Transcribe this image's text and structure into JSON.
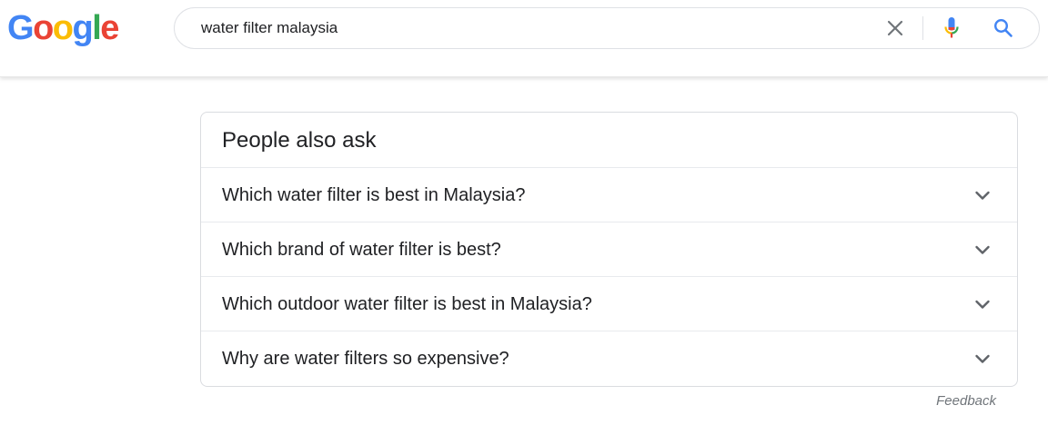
{
  "logo": {
    "letters": [
      "G",
      "o",
      "o",
      "g",
      "l",
      "e"
    ],
    "colors": [
      "#4285F4",
      "#EA4335",
      "#FBBC05",
      "#4285F4",
      "#34A853",
      "#EA4335"
    ]
  },
  "search": {
    "value": "water filter malaysia",
    "clear_icon": "close-icon",
    "mic_icon": "mic-icon",
    "search_icon": "search-icon"
  },
  "people_also_ask": {
    "title": "People also ask",
    "questions": [
      "Which water filter is best in Malaysia?",
      "Which brand of water filter is best?",
      "Which outdoor water filter is best in Malaysia?",
      "Why are water filters so expensive?"
    ],
    "expand_icon": "chevron-down-icon"
  },
  "feedback_label": "Feedback",
  "colors": {
    "search_blue": "#4285F4",
    "text": "#202124",
    "muted": "#70757a",
    "border": "#dadce0"
  }
}
